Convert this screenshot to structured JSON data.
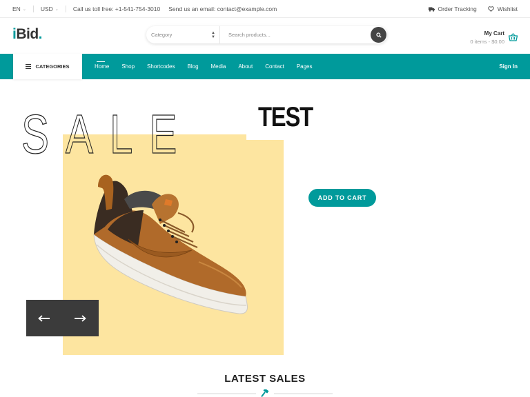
{
  "topbar": {
    "language": "EN",
    "currency": "USD",
    "phone_text": "Call us toll free: +1-541-754-3010",
    "email_text": "Send us an email: contact@example.com",
    "order_tracking": "Order Tracking",
    "wishlist": "Wishlist"
  },
  "header": {
    "logo_i": "i",
    "logo_rest": "Bid",
    "logo_dot": ".",
    "search_category": "Category",
    "search_placeholder": "Search products...",
    "cart_title": "My Cart",
    "cart_summary": "0 items - $0.00"
  },
  "nav": {
    "categories_label": "CATEGORIES",
    "items": [
      "Home",
      "Shop",
      "Shortcodes",
      "Blog",
      "Media",
      "About",
      "Contact",
      "Pages"
    ],
    "active_index": 0,
    "signin": "Sign In"
  },
  "hero": {
    "sale_text": "SALE",
    "test_text": "TEST",
    "add_to_cart": "ADD TO CART"
  },
  "latest": {
    "title": "LATEST SALES"
  },
  "colors": {
    "accent": "#009a9b",
    "hero_yellow": "#fde5a0",
    "dark": "#3b3b3b"
  },
  "icons": [
    "chevron-down-icon",
    "truck-icon",
    "heart-icon",
    "search-icon",
    "basket-icon",
    "menu-icon",
    "arrow-left-icon",
    "arrow-right-icon",
    "hammer-icon"
  ]
}
